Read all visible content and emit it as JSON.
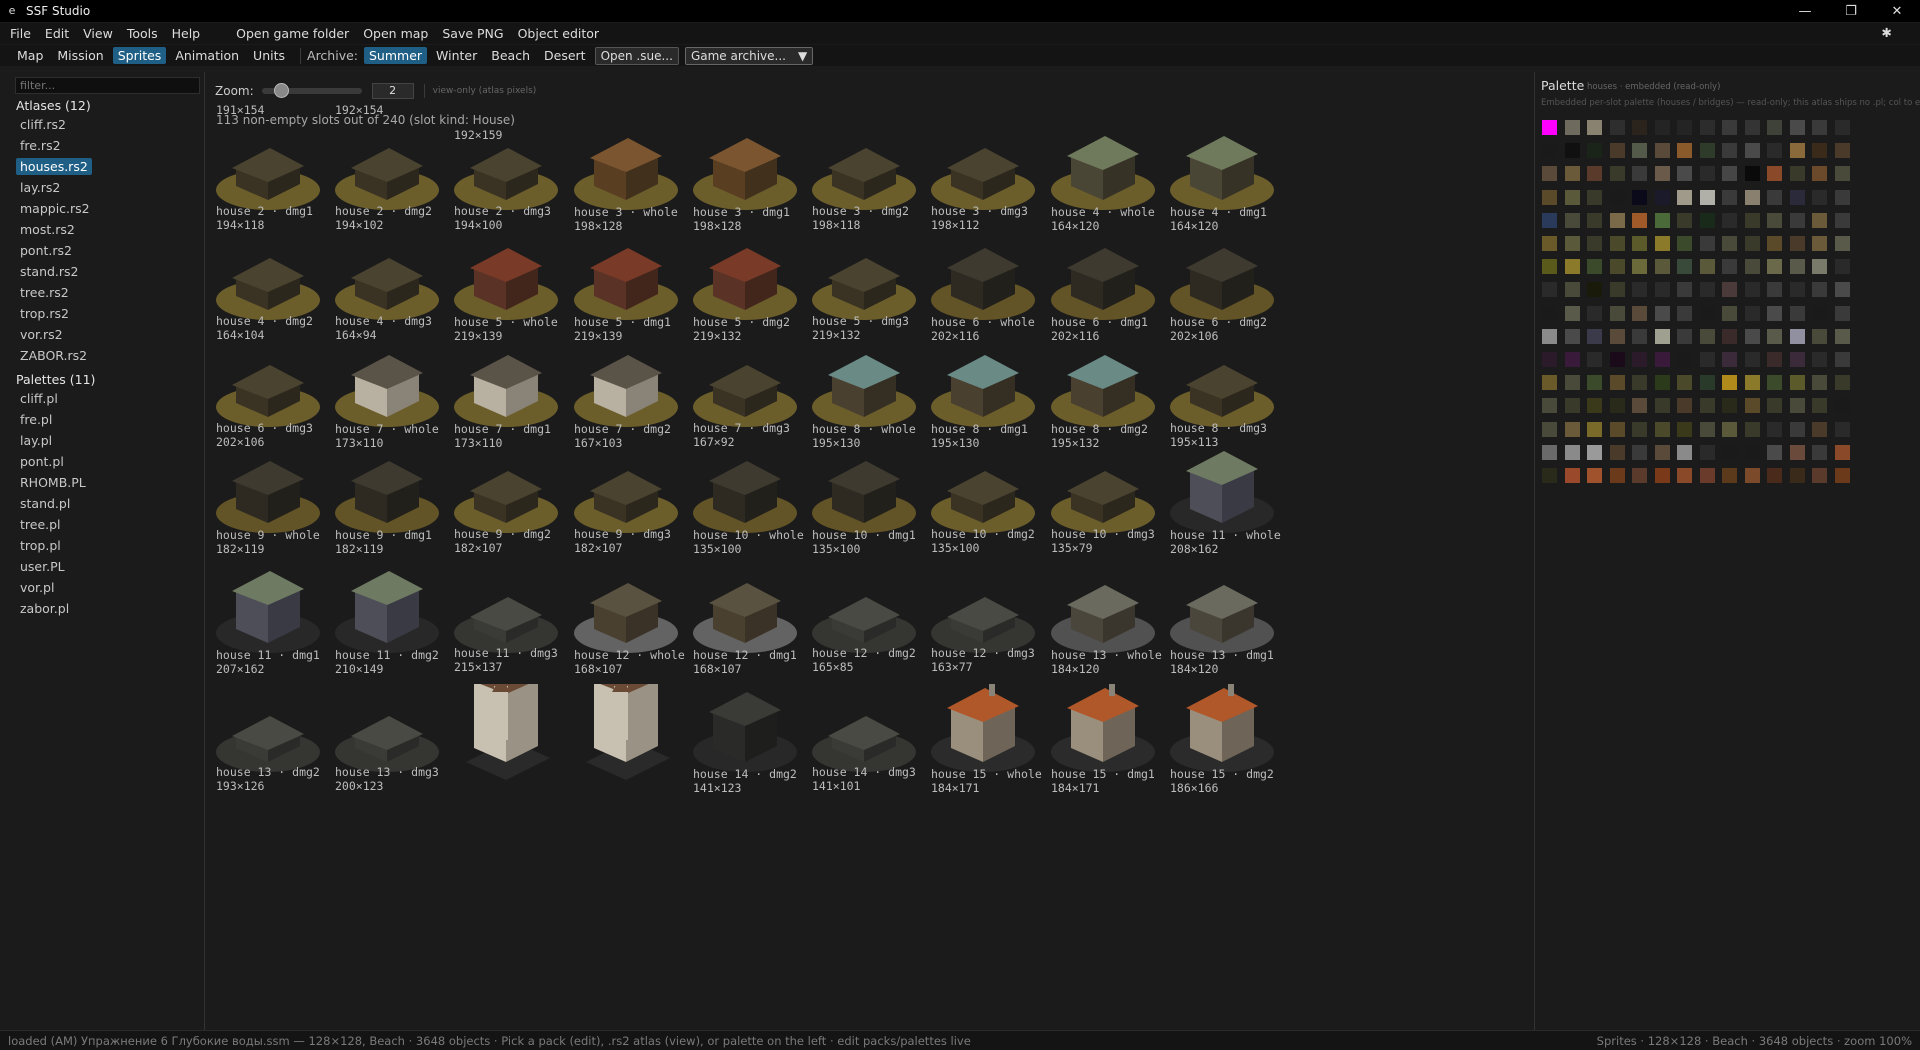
{
  "window": {
    "title": "SSF Studio"
  },
  "menu": {
    "items": [
      "File",
      "Edit",
      "View",
      "Tools",
      "Help"
    ],
    "actions": [
      "Open game folder",
      "Open map",
      "Save PNG",
      "Object editor"
    ],
    "star": "✱"
  },
  "toolbar": {
    "tabs": [
      "Map",
      "Mission",
      "Sprites",
      "Animation",
      "Units"
    ],
    "active_tab": "Sprites",
    "archive_label": "Archive:",
    "archive_tabs": [
      "Summer",
      "Winter",
      "Beach",
      "Desert"
    ],
    "active_archive": "Summer",
    "open_button": "Open .sue...",
    "combo_label": "Game archive..."
  },
  "sidebar": {
    "filter_placeholder": "filter...",
    "atlases_heading": "Atlases (12)",
    "atlases": [
      "cliff.rs2",
      "fre.rs2",
      "houses.rs2",
      "lay.rs2",
      "mappic.rs2",
      "most.rs2",
      "pont.rs2",
      "stand.rs2",
      "tree.rs2",
      "trop.rs2",
      "vor.rs2",
      "ZABOR.rs2"
    ],
    "active_atlas": "houses.rs2",
    "palettes_heading": "Palettes (11)",
    "palettes": [
      "cliff.pl",
      "fre.pl",
      "lay.pl",
      "pont.pl",
      "RHOMB.PL",
      "stand.pl",
      "tree.pl",
      "trop.pl",
      "user.PL",
      "vor.pl",
      "zabor.pl"
    ]
  },
  "viewer": {
    "zoom_label": "Zoom:",
    "zoom_value": "2",
    "zoom_note": "view-only (atlas pixels)",
    "summary": "113 non-empty slots out of 240 (slot kind: House)",
    "partial_row": [
      "191×154",
      "192×154",
      "192×159"
    ],
    "sprites": [
      {
        "name": "house 2 · dmg1",
        "dims": "194×118",
        "style": "ruin"
      },
      {
        "name": "house 2 · dmg2",
        "dims": "194×102",
        "style": "ruin"
      },
      {
        "name": "house 2 · dmg3",
        "dims": "194×100",
        "style": "ruin"
      },
      {
        "name": "house 3 · whole",
        "dims": "198×128",
        "style": "brown"
      },
      {
        "name": "house 3 · dmg1",
        "dims": "198×128",
        "style": "brown"
      },
      {
        "name": "house 3 · dmg2",
        "dims": "198×118",
        "style": "ruin"
      },
      {
        "name": "house 3 · dmg3",
        "dims": "198×112",
        "style": "ruin"
      },
      {
        "name": "house 4 · whole",
        "dims": "164×120",
        "style": "green"
      },
      {
        "name": "house 4 · dmg1",
        "dims": "164×120",
        "style": "green"
      },
      {
        "name": "house 4 · dmg2",
        "dims": "164×104",
        "style": "ruin"
      },
      {
        "name": "house 4 · dmg3",
        "dims": "164×94",
        "style": "ruin"
      },
      {
        "name": "house 5 · whole",
        "dims": "219×139",
        "style": "red"
      },
      {
        "name": "house 5 · dmg1",
        "dims": "219×139",
        "style": "red"
      },
      {
        "name": "house 5 · dmg2",
        "dims": "219×132",
        "style": "red"
      },
      {
        "name": "house 5 · dmg3",
        "dims": "219×132",
        "style": "ruin"
      },
      {
        "name": "house 6 · whole",
        "dims": "202×116",
        "style": "dark"
      },
      {
        "name": "house 6 · dmg1",
        "dims": "202×116",
        "style": "dark"
      },
      {
        "name": "house 6 · dmg2",
        "dims": "202×106",
        "style": "dark"
      },
      {
        "name": "house 6 · dmg3",
        "dims": "202×106",
        "style": "ruin"
      },
      {
        "name": "house 7 · whole",
        "dims": "173×110",
        "style": "white"
      },
      {
        "name": "house 7 · dmg1",
        "dims": "173×110",
        "style": "white"
      },
      {
        "name": "house 7 · dmg2",
        "dims": "167×103",
        "style": "white"
      },
      {
        "name": "house 7 · dmg3",
        "dims": "167×92",
        "style": "ruin"
      },
      {
        "name": "house 8 · whole",
        "dims": "195×130",
        "style": "teal"
      },
      {
        "name": "house 8 · dmg1",
        "dims": "195×130",
        "style": "teal"
      },
      {
        "name": "house 8 · dmg2",
        "dims": "195×132",
        "style": "teal"
      },
      {
        "name": "house 8 · dmg3",
        "dims": "195×113",
        "style": "ruin"
      },
      {
        "name": "house 9 · whole",
        "dims": "182×119",
        "style": "dark"
      },
      {
        "name": "house 9 · dmg1",
        "dims": "182×119",
        "style": "dark"
      },
      {
        "name": "house 9 · dmg2",
        "dims": "182×107",
        "style": "ruin"
      },
      {
        "name": "house 9 · dmg3",
        "dims": "182×107",
        "style": "ruin"
      },
      {
        "name": "house 10 · whole",
        "dims": "135×100",
        "style": "dark"
      },
      {
        "name": "house 10 · dmg1",
        "dims": "135×100",
        "style": "dark"
      },
      {
        "name": "house 10 · dmg2",
        "dims": "135×100",
        "style": "ruin"
      },
      {
        "name": "house 10 · dmg3",
        "dims": "135×79",
        "style": "ruin"
      },
      {
        "name": "house 11 · whole",
        "dims": "208×162",
        "style": "block"
      },
      {
        "name": "house 11 · dmg1",
        "dims": "207×162",
        "style": "block"
      },
      {
        "name": "house 11 · dmg2",
        "dims": "210×149",
        "style": "block"
      },
      {
        "name": "house 11 · dmg3",
        "dims": "215×137",
        "style": "rubble"
      },
      {
        "name": "house 12 · whole",
        "dims": "168×107",
        "style": "barn"
      },
      {
        "name": "house 12 · dmg1",
        "dims": "168×107",
        "style": "barn"
      },
      {
        "name": "house 12 · dmg2",
        "dims": "165×85",
        "style": "rubble"
      },
      {
        "name": "house 12 · dmg3",
        "dims": "163×77",
        "style": "rubble"
      },
      {
        "name": "house 13 · whole",
        "dims": "184×120",
        "style": "long"
      },
      {
        "name": "house 13 · dmg1",
        "dims": "184×120",
        "style": "long"
      },
      {
        "name": "house 13 · dmg2",
        "dims": "193×126",
        "style": "rubble"
      },
      {
        "name": "house 13 · dmg3",
        "dims": "200×123",
        "style": "rubble"
      },
      {
        "name": "",
        "dims": "",
        "style": "church"
      },
      {
        "name": "",
        "dims": "",
        "style": "church"
      },
      {
        "name": "house 14 · dmg2",
        "dims": "141×123",
        "style": "darkblock"
      },
      {
        "name": "house 14 · dmg3",
        "dims": "141×101",
        "style": "rubble"
      },
      {
        "name": "house 15 · whole",
        "dims": "184×171",
        "style": "orange"
      },
      {
        "name": "house 15 · dmg1",
        "dims": "184×171",
        "style": "orange"
      },
      {
        "name": "house 15 · dmg2",
        "dims": "186×166",
        "style": "orange"
      }
    ]
  },
  "palette": {
    "title": "Palette",
    "subtitle": "houses · embedded (read-only)",
    "description": "Embedded per-slot palette (houses / bridges) — read-only; this atlas ships no .pl; col to edit",
    "colors": [
      "#ff00ff",
      "#6e6a5e",
      "#8a8270",
      "#2e2e2e",
      "#2a241c",
      "#242424",
      "#242424",
      "#2c2c2c",
      "#3a3a3a",
      "#343434",
      "#3e4238",
      "#4a4a4a",
      "#3a3a3a",
      "#2a2a2a",
      "#1a1a1a",
      "#101010",
      "#1a2418",
      "#4a3a2a",
      "#545a4a",
      "#5a4a3a",
      "#8a5a2a",
      "#2e3a2a",
      "#3a3a3a",
      "#4a4a4a",
      "#2a2a2a",
      "#8a6a3a",
      "#3a2a1a",
      "#4a3a2a",
      "#5a4a3a",
      "#6a5a3a",
      "#5a3a2a",
      "#3a3a2a",
      "#3a3a3a",
      "#6a5a4a",
      "#4a4a4a",
      "#2a2a2a",
      "#464646",
      "#0a0a0a",
      "#8a4a2a",
      "#3a3a2a",
      "#6a4a2a",
      "#4a4a3a",
      "#5a4a2a",
      "#5a5a3a",
      "#3a3a2a",
      "#1a1a1a",
      "#0a0a1a",
      "#1a1a2a",
      "#a09a8a",
      "#b0b0a8",
      "#3a3a3a",
      "#8a8070",
      "#3a3a3a",
      "#2a2a3a",
      "#2a2a2a",
      "#3a3a3a",
      "#2a3a5a",
      "#4a4a3a",
      "#3a3a2a",
      "#7a6a4a",
      "#a05a2a",
      "#4a6a3a",
      "#3a3a2a",
      "#1a2a1a",
      "#2a2a2a",
      "#3a3a2a",
      "#4a4a3a",
      "#3a3a3a",
      "#6a5a3a",
      "#3a3a3a",
      "#6a5a2a",
      "#5a5a3a",
      "#3a3a2a",
      "#4a4a2a",
      "#5a5a2a",
      "#8a7a2a",
      "#3a4a2a",
      "#3a3a3a",
      "#4a4a3a",
      "#3a3a2a",
      "#5a4a2a",
      "#4a3a2a",
      "#6a5a3a",
      "#5a5a4a",
      "#5a5a1a",
      "#8a7a2a",
      "#3a4a2a",
      "#4a4a2a",
      "#6a6a3a",
      "#5a5a3a",
      "#3a4a3a",
      "#5a5a3a",
      "#3a3a3a",
      "#4a4a3a",
      "#6a6a4a",
      "#5a5a4a",
      "#7a7a6a",
      "#2a2a2a",
      "#2a2a2a",
      "#4a4a3a",
      "#1a1a0a",
      "#3a3a2a",
      "#2a2a2a",
      "#2a2a2a",
      "#3a3a3a",
      "#2a2a2a",
      "#4a3a3a",
      "#2a2a2a",
      "#3a3a3a",
      "#2a2a2a",
      "#3a3a3a",
      "#4a4a4a",
      "#1a1a1a",
      "#5a5a4a",
      "#2a2a2a",
      "#4a4a3a",
      "#5a4a3a",
      "#4a4a4a",
      "#3a3a3a",
      "#1a1a1a",
      "#4a4a3a",
      "#2a2a2a",
      "#4a4a4a",
      "#3a3a3a",
      "#1a1a1a",
      "#3a3a3a",
      "#8a8a8a",
      "#4a4a4a",
      "#3a3a4a",
      "#5a4a3a",
      "#3a3a3a",
      "#a0a090",
      "#3a3a3a",
      "#4a4a3a",
      "#3a2a2a",
      "#4a4a4a",
      "#5a5a4a",
      "#9090a0",
      "#4a4a3a",
      "#5a5a4a",
      "#2a1a2a",
      "#3a1a3a",
      "#2a2a2a",
      "#1a0a1a",
      "#2a1a2a",
      "#3a1a3a",
      "#1a1a1a",
      "#2a2a2a",
      "#3a2a3a",
      "#2a2a2a",
      "#3a2a2a",
      "#3a2a3a",
      "#2a2a2a",
      "#3a3a3a",
      "#6a5a2a",
      "#4a4a3a",
      "#3a4a2a",
      "#5a4a2a",
      "#3a3a2a",
      "#2a3a1a",
      "#4a4a2a",
      "#2a3a2a",
      "#b08a1a",
      "#8a7a2a",
      "#3a4a2a",
      "#5a5a2a",
      "#4a4a3a",
      "#3a3a2a",
      "#4a4a3a",
      "#3a3a2a",
      "#3a3a1a",
      "#2a2a1a",
      "#5a4a3a",
      "#3a3a2a",
      "#4a3a2a",
      "#3a3a2a",
      "#2a2a1a",
      "#5a4a2a",
      "#3a3a2a",
      "#4a4a3a",
      "#3a3a2a",
      "#1a1a1a",
      "#4a4a3a",
      "#6a5a3a",
      "#7a6a2a",
      "#5a4a2a",
      "#3a3a2a",
      "#4a4a2a",
      "#3a3a1a",
      "#4a4a3a",
      "#5a5a3a",
      "#3a3a2a",
      "#2a2a2a",
      "#3a3a3a",
      "#4a3a2a",
      "#2a2a2a",
      "#6a6a6a",
      "#8a8a8a",
      "#9a9a9a",
      "#4a3a2a",
      "#3a3a3a",
      "#5a4a3a",
      "#8a8a8a",
      "#2a2a2a",
      "#1a1a1a",
      "#1a1a1a",
      "#4a4a4a",
      "#6a4a3a",
      "#3a3a3a",
      "#8a4a2a",
      "#2a2a1a",
      "#9a4a2a",
      "#a0522d",
      "#6a3a1a",
      "#5a3a2a",
      "#7a3a1a",
      "#8a4a2a",
      "#6a3a2a",
      "#5a3a1a",
      "#7a4a2a",
      "#4a2a1a",
      "#3a2a1a",
      "#5a3a2a",
      "#6a3a1a"
    ]
  },
  "status": {
    "left": "loaded (AM) Упражнение 6 Глубокие воды.ssm — 128×128, Beach · 3648 objects · Pick a pack (edit), .rs2 atlas (view), or palette on the left · edit packs/palettes live",
    "right": "Sprites · 128×128 · Beach · 3648 objects · zoom 100%"
  },
  "accents": {
    "selection": "#1f5f86",
    "window_bg": "#1b1b1b"
  }
}
